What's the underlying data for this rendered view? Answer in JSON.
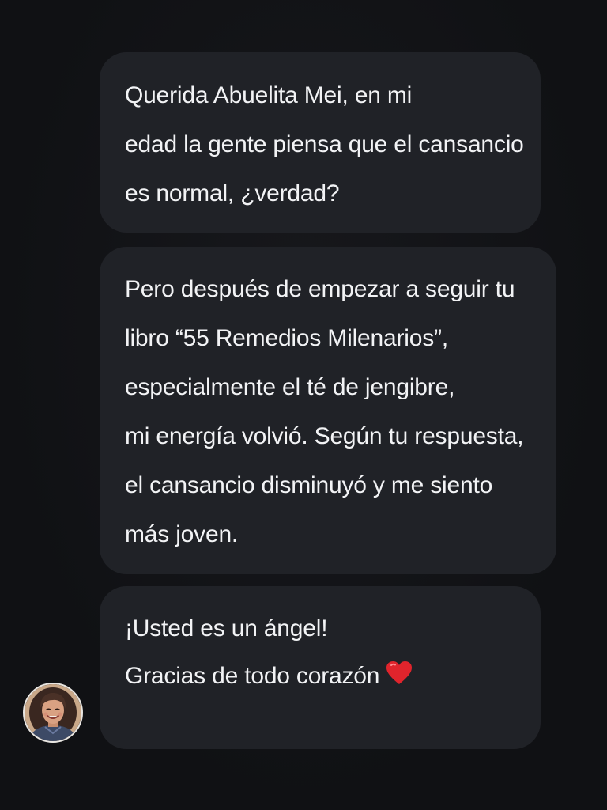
{
  "messages": [
    {
      "lines": [
        "Querida Abuelita Mei, en mi",
        "edad la gente piensa que el cansancio",
        "es normal, ¿verdad?"
      ]
    },
    {
      "lines": [
        "Pero después de empezar a seguir tu",
        "libro “55 Remedios Milenarios”,",
        "especialmente el té de jengibre,",
        "mi energía volvió. Según tu respuesta,",
        "el cansancio disminuyó y me siento",
        "más joven."
      ]
    },
    {
      "lines": [
        "¡Usted es un ángel!",
        "Gracias de todo corazón"
      ],
      "trailing_icon": "heart-icon"
    }
  ],
  "colors": {
    "background": "#111215",
    "bubble": "#202227",
    "text": "#f2f3f5",
    "heart": "#e0242c"
  },
  "avatar": {
    "icon": "avatar"
  }
}
